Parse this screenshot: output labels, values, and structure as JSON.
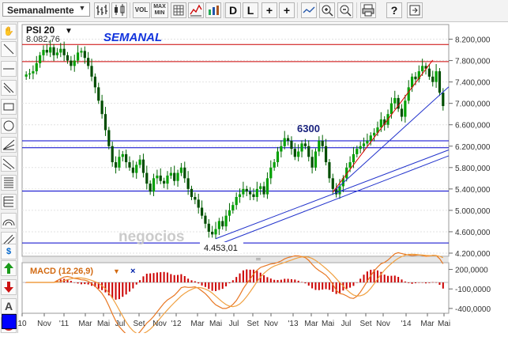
{
  "toolbar": {
    "period": "Semanalmente",
    "buttons": [
      {
        "name": "line-type-button",
        "icon": "bar-chart-icon",
        "text": ""
      },
      {
        "name": "candles-button",
        "icon": "candlestick-icon",
        "text": ""
      },
      {
        "name": "volume-button",
        "icon": "volume-icon",
        "text": "VOL"
      },
      {
        "name": "maxmin-button",
        "icon": "maxmin-icon",
        "text": "MAX MIN"
      },
      {
        "name": "grid-button",
        "icon": "grid-icon",
        "text": ""
      },
      {
        "name": "indicators-button",
        "icon": "indicator-icon",
        "text": ""
      },
      {
        "name": "compare-button",
        "icon": "compare-icon",
        "text": ""
      },
      {
        "name": "daily-button",
        "icon": "D",
        "text": "D"
      },
      {
        "name": "log-button",
        "icon": "L",
        "text": "L"
      },
      {
        "name": "crosshair-button",
        "icon": "crosshair-icon",
        "text": "+"
      },
      {
        "name": "crosshair-label-button",
        "icon": "crosshair-label-icon",
        "text": "+"
      },
      {
        "name": "trend-button",
        "icon": "trend-icon",
        "text": ""
      },
      {
        "name": "zoom-in-button",
        "icon": "zoom-in-icon",
        "text": ""
      },
      {
        "name": "zoom-out-button",
        "icon": "zoom-out-icon",
        "text": ""
      },
      {
        "name": "print-button",
        "icon": "print-icon",
        "text": ""
      },
      {
        "name": "help-button",
        "icon": "help-icon",
        "text": "?"
      },
      {
        "name": "export-button",
        "icon": "export-icon",
        "text": ""
      }
    ]
  },
  "leftbar": {
    "tools": [
      "hand-icon",
      "line-icon",
      "hline-icon",
      "ray-icon",
      "rectangle-icon",
      "circle-icon",
      "fan-icon",
      "fibonacci-icon",
      "fib-fan-icon",
      "fib-retracement-icon",
      "arc-icon",
      "channel-icon",
      "dollar-icon",
      "buy-arrow-icon",
      "sell-arrow-icon",
      "text-icon",
      "delete-icon"
    ]
  },
  "main": {
    "symbol": "PSI 20",
    "symbol_value": "8.082,76",
    "period_title": "SEMANAL",
    "annotation_high": "6300",
    "annotation_low": "4.453,01",
    "watermark": "negocios",
    "y_axis": [
      "8.200,000",
      "7.800,000",
      "7.400,000",
      "7.000,000",
      "6.600,000",
      "6.200,000",
      "5.800,000",
      "5.400,000",
      "5.000,000",
      "4.600,000",
      "4.200,000"
    ],
    "colors": {
      "price": "#008000",
      "hlines": "#0000cc",
      "resistance": "#cc0000",
      "trend": "#2233cc"
    }
  },
  "macd": {
    "label": "MACD (12,26,9)",
    "y_axis": [
      "200,0000",
      "-100,0000",
      "-400,0000"
    ],
    "colors": {
      "macd": "#e87722",
      "signal": "#ff9900",
      "hist": "#cc0000"
    }
  },
  "x_axis": [
    "10",
    "Nov",
    "'11",
    "Mar",
    "Mai",
    "Jul",
    "Set",
    "Nov",
    "'12",
    "Mar",
    "Mai",
    "Jul",
    "Set",
    "Nov",
    "'13",
    "Mar",
    "Mai",
    "Jul",
    "Set",
    "Nov",
    "'14",
    "Mar",
    "Mai"
  ],
  "chart_data": {
    "type": "candlestick",
    "title": "SEMANAL",
    "series": [
      {
        "name": "PSI 20",
        "values": [
          7540,
          7560,
          7600,
          7750,
          7900,
          8000,
          7950,
          8050,
          7900,
          7950,
          8020,
          7900,
          7800,
          7700,
          7800,
          7950,
          7980,
          7850,
          7700,
          7500,
          7300,
          7050,
          6800,
          6500,
          6200,
          5900,
          5800,
          6000,
          6050,
          5900,
          5800,
          5700,
          5850,
          5950,
          5700,
          5500,
          5350,
          5600,
          5650,
          5550,
          5500,
          5650,
          5700,
          5550,
          5700,
          5800,
          5600,
          5400,
          5250,
          5200,
          5050,
          4900,
          4750,
          4600,
          4550,
          4650,
          4800,
          4700,
          4900,
          5000,
          5100,
          5250,
          5300,
          5400,
          5350,
          5300,
          5250,
          5400,
          5450,
          5300,
          5600,
          5800,
          5900,
          6100,
          6200,
          6350,
          6300,
          6150,
          6000,
          6100,
          6250,
          6200,
          6000,
          5800,
          6100,
          6300,
          6200,
          5900,
          5600,
          5400,
          5300,
          5450,
          5600,
          5800,
          5900,
          6050,
          6150,
          6200,
          6250,
          6300,
          6400,
          6450,
          6550,
          6700,
          6600,
          6800,
          7000,
          7100,
          6900,
          6750,
          7050,
          7300,
          7500,
          7450,
          7600,
          7700,
          7650,
          7500,
          7400,
          7600,
          7200,
          6950
        ]
      }
    ],
    "ylim": [
      4200,
      8400
    ],
    "xlabel": "",
    "ylabel": ""
  }
}
